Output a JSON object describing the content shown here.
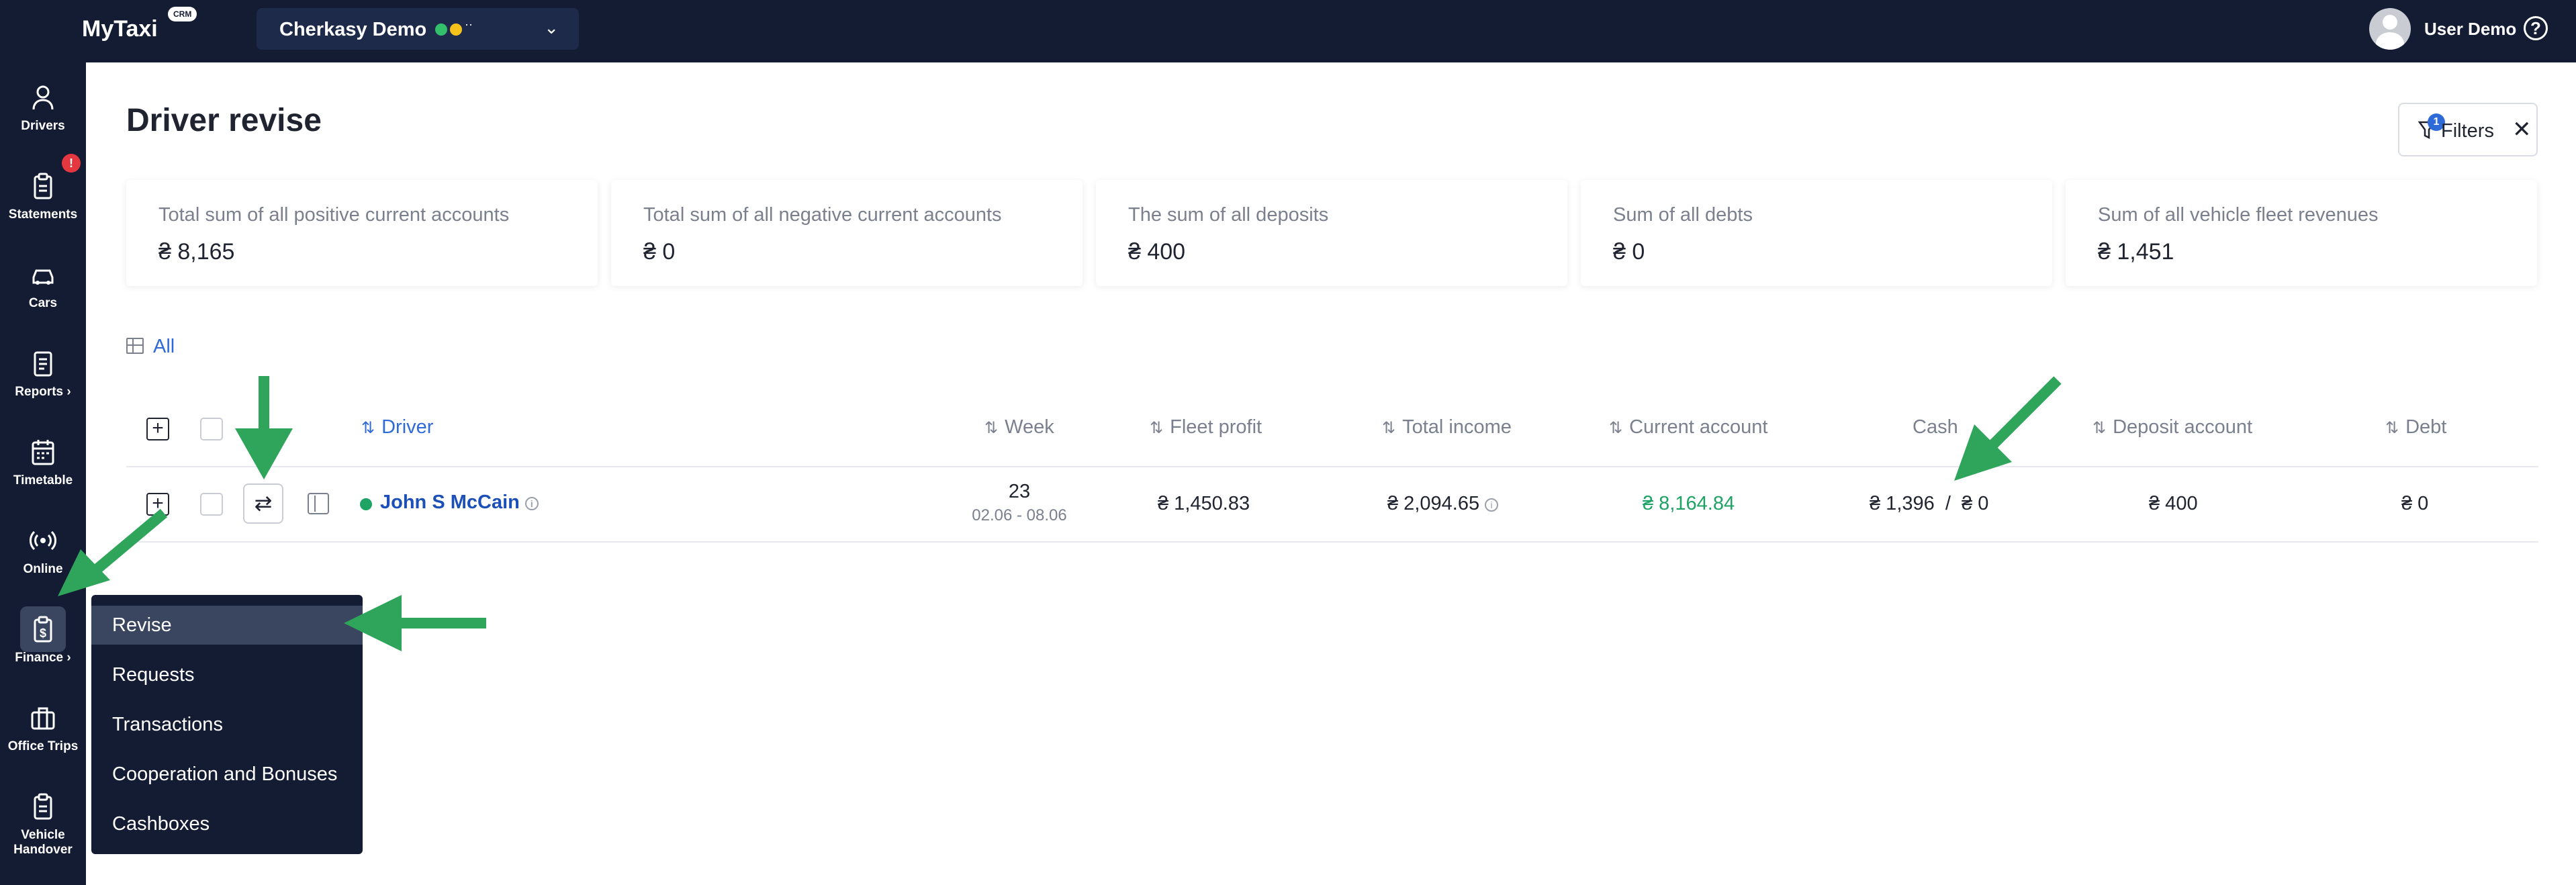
{
  "topbar": {
    "logo": "MyTaxi",
    "logo_badge": "CRM",
    "fleet_name": "Cherkasy Demo",
    "user_name": "User Demo",
    "help_glyph": "?"
  },
  "sidebar": {
    "items": [
      {
        "label": "Drivers",
        "icon": "user-icon",
        "glyph": "👤"
      },
      {
        "label": "Statements",
        "icon": "clipboard-icon",
        "glyph": "📋",
        "badge": "!"
      },
      {
        "label": "Cars",
        "icon": "car-icon",
        "glyph": "🚘"
      },
      {
        "label": "Reports ›",
        "icon": "report-icon",
        "glyph": "📄"
      },
      {
        "label": "Timetable",
        "icon": "calendar-icon",
        "glyph": "📅"
      },
      {
        "label": "Online",
        "icon": "broadcast-icon",
        "glyph": "((•))"
      },
      {
        "label": "Finance ›",
        "icon": "finance-icon",
        "glyph": "💲"
      },
      {
        "label": "Office Trips",
        "icon": "briefcase-icon",
        "glyph": "💼"
      },
      {
        "label": "Vehicle Handover",
        "icon": "handover-icon",
        "glyph": "📋"
      }
    ]
  },
  "main": {
    "title": "Driver revise",
    "filters_label": "Filters",
    "filters_count": "1",
    "view_all": "All"
  },
  "stats": [
    {
      "label": "Total sum of all positive current accounts",
      "value": "₴ 8,165"
    },
    {
      "label": "Total sum of all negative current accounts",
      "value": "₴ 0"
    },
    {
      "label": "The sum of all deposits",
      "value": "₴ 400"
    },
    {
      "label": "Sum of all debts",
      "value": "₴ 0"
    },
    {
      "label": "Sum of all vehicle fleet revenues",
      "value": "₴ 1,451"
    }
  ],
  "table": {
    "headers": {
      "driver": "Driver",
      "week": "Week",
      "fleet_profit": "Fleet profit",
      "total_income": "Total income",
      "current_account": "Current account",
      "cash": "Cash",
      "deposit_account": "Deposit account",
      "debt": "Debt"
    },
    "rows": [
      {
        "driver": "John S McCain",
        "week": "23",
        "week_range": "02.06 - 08.06",
        "fleet_profit": "₴ 1,450.83",
        "total_income": "₴ 2,094.65",
        "current_account": "₴ 8,164.84",
        "cash": "₴ 1,396  /  ₴ 0",
        "deposit_account": "₴ 400",
        "debt": "₴ 0"
      }
    ]
  },
  "finance_menu": {
    "items": [
      "Revise",
      "Requests",
      "Transactions",
      "Cooperation and Bonuses",
      "Cashboxes"
    ],
    "active": "Revise"
  },
  "colors": {
    "nav_bg": "#141c33",
    "accent_blue": "#2f6ad9",
    "positive_green": "#1fa365",
    "annotation_arrow": "#2ea55b"
  }
}
